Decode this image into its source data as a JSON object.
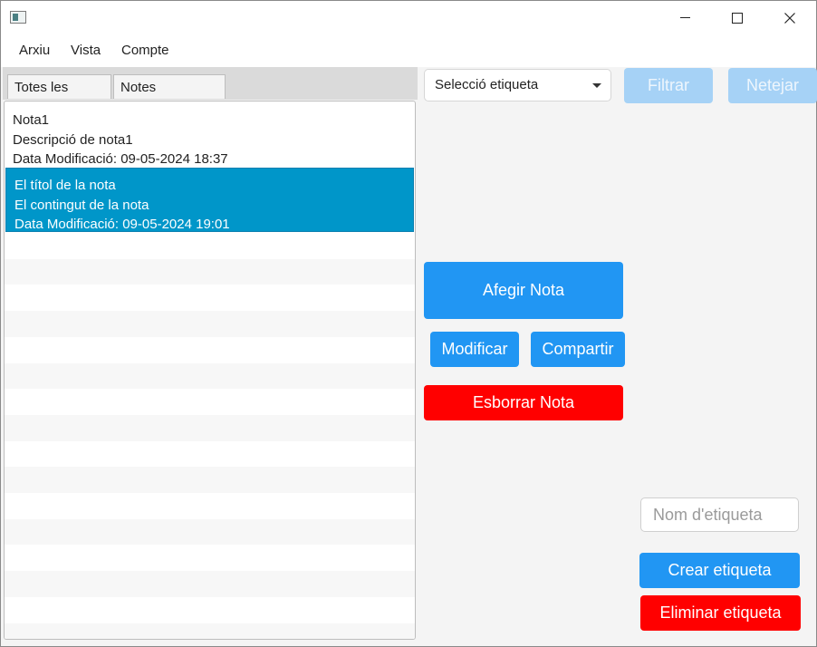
{
  "window": {
    "icon": "app-window-icon"
  },
  "menubar": {
    "items": [
      "Arxiu",
      "Vista",
      "Compte"
    ]
  },
  "tabs": [
    {
      "label": "Totes les Notes"
    },
    {
      "label": "Notes preferides"
    }
  ],
  "notes": [
    {
      "title": "Nota1",
      "description": "Descripció de nota1",
      "modified": "Data Modificació: 09-05-2024 18:37",
      "selected": false
    },
    {
      "title": "El títol de la nota",
      "description": "El contingut de la nota",
      "modified": "Data Modificació: 09-05-2024 19:01",
      "selected": true
    }
  ],
  "filter": {
    "select_value": "Selecció etiqueta",
    "filter_label": "Filtrar",
    "clear_label": "Netejar"
  },
  "actions": {
    "add": "Afegir Nota",
    "modify": "Modificar",
    "share": "Compartir",
    "delete": "Esborrar Nota"
  },
  "tag": {
    "placeholder": "Nom d'etiqueta",
    "create": "Crear etiqueta",
    "remove": "Eliminar etiqueta"
  },
  "colors": {
    "accent": "#2196f3",
    "danger": "#ff0000",
    "selection": "#0096c9",
    "disabled": "#a6d2f6"
  }
}
